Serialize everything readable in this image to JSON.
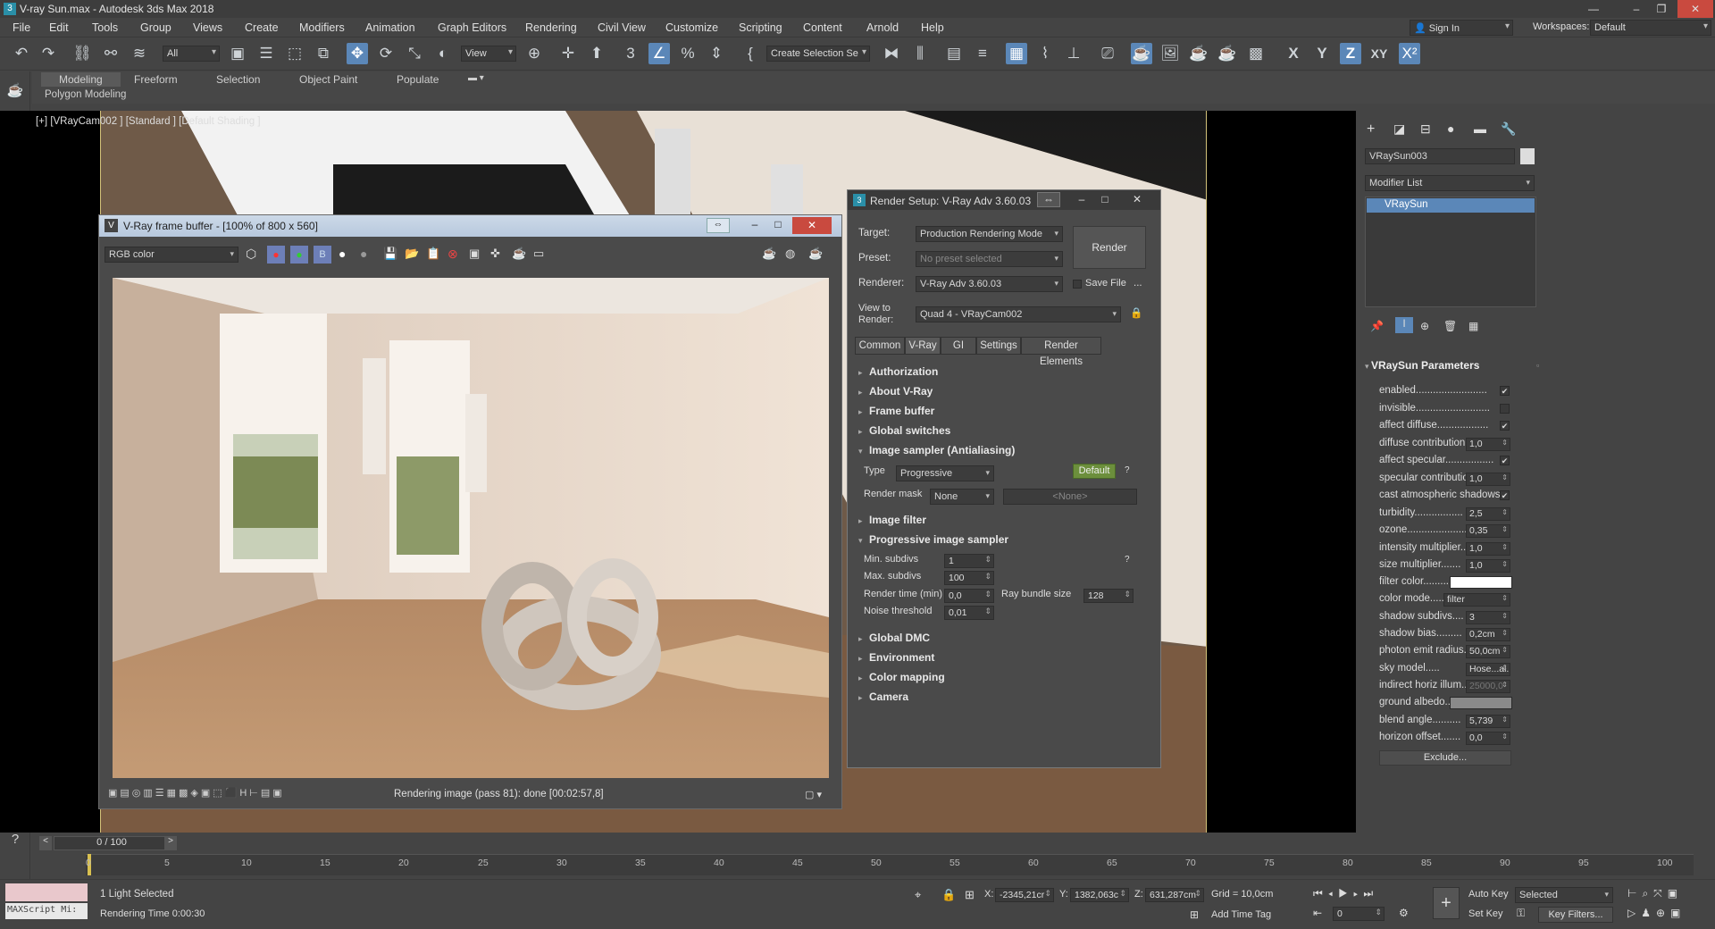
{
  "window": {
    "title": "V-ray Sun.max - Autodesk 3ds Max 2018"
  },
  "menu": [
    "File",
    "Edit",
    "Tools",
    "Group",
    "Views",
    "Create",
    "Modifiers",
    "Animation",
    "Graph Editors",
    "Rendering",
    "Civil View",
    "Customize",
    "Scripting",
    "Content",
    "Arnold",
    "Help"
  ],
  "account": {
    "sign_in": "Sign In",
    "workspaces_label": "Workspaces:",
    "workspace": "Default"
  },
  "toolbar": {
    "filter": "All",
    "ref_coord": "View",
    "selection_set": "Create Selection Se",
    "axes": [
      "X",
      "Y",
      "Z",
      "XY"
    ]
  },
  "ribbon": {
    "tabs": [
      "Modeling",
      "Freeform",
      "Selection",
      "Object Paint",
      "Populate"
    ],
    "sub": "Polygon Modeling"
  },
  "viewport": {
    "label_plus": "[+]",
    "label_cam": "[VRayCam002 ]",
    "label_std": "[Standard ]",
    "label_shading": "[Default Shading ]"
  },
  "vfb": {
    "title": "V-Ray frame buffer - [100% of 800 x 560]",
    "channel": "RGB color",
    "status": "Rendering image (pass 81): done [00:02:57,8]"
  },
  "render_setup": {
    "title": "Render Setup: V-Ray Adv 3.60.03",
    "target_label": "Target:",
    "target": "Production Rendering Mode",
    "preset_label": "Preset:",
    "preset": "No preset selected",
    "renderer_label": "Renderer:",
    "renderer": "V-Ray Adv 3.60.03",
    "save_file": "Save File",
    "ellipsis": "...",
    "view_label": "View to Render:",
    "view": "Quad 4 - VRayCam002",
    "render_button": "Render",
    "tabs": [
      "Common",
      "V-Ray",
      "GI",
      "Settings",
      "Render Elements"
    ],
    "rollouts_top": [
      "Authorization",
      "About V-Ray",
      "Frame buffer",
      "Global switches",
      "Image sampler (Antialiasing)"
    ],
    "type_label": "Type",
    "type": "Progressive",
    "default_btn": "Default",
    "help": "?",
    "mask_label": "Render mask",
    "mask": "None",
    "mask_none": "<None>",
    "image_filter": "Image filter",
    "progressive": "Progressive image sampler",
    "min_subdivs_label": "Min. subdivs",
    "min_subdivs": "1",
    "max_subdivs_label": "Max. subdivs",
    "max_subdivs": "100",
    "render_time_label": "Render time (min)",
    "render_time": "0,0",
    "bundle_label": "Ray bundle size",
    "bundle": "128",
    "noise_label": "Noise threshold",
    "noise": "0,01",
    "rollouts_bottom": [
      "Global DMC",
      "Environment",
      "Color mapping",
      "Camera"
    ]
  },
  "command_panel": {
    "object_name": "VRaySun003",
    "modifier_list": "Modifier List",
    "stack_item": "VRaySun",
    "params_title": "VRaySun Parameters",
    "params": [
      {
        "label": "enabled.........................",
        "check": "✔"
      },
      {
        "label": "invisible..........................",
        "check": ""
      },
      {
        "label": "affect diffuse..................",
        "check": "✔"
      },
      {
        "label": "diffuse contribution",
        "value": "1,0"
      },
      {
        "label": "affect specular.................",
        "check": "✔"
      },
      {
        "label": "specular contributio",
        "value": "1,0"
      },
      {
        "label": "cast atmospheric shadows..",
        "check": "✔"
      },
      {
        "label": "turbidity.................",
        "value": "2,5"
      },
      {
        "label": "ozone.....................",
        "value": "0,35"
      },
      {
        "label": "intensity multiplier..",
        "value": "1,0"
      },
      {
        "label": "size multiplier.......",
        "value": "1,0"
      },
      {
        "label": "filter color.........",
        "swatch": "#ffffff"
      },
      {
        "label": "color mode.....",
        "select": "filter"
      },
      {
        "label": "shadow subdivs....",
        "value": "3"
      },
      {
        "label": "shadow bias.........",
        "value": "0,2cm"
      },
      {
        "label": "photon emit radius.",
        "value": "50,0cm"
      },
      {
        "label": "sky model.....",
        "select": "Hose...al."
      },
      {
        "label": "indirect horiz illum..",
        "value": "25000,0"
      },
      {
        "label": "ground albedo..",
        "swatch": "#8a8a8a"
      },
      {
        "label": "blend angle..........",
        "value": "5,739"
      },
      {
        "label": "horizon offset.......",
        "value": "0,0"
      }
    ],
    "exclude": "Exclude..."
  },
  "timeline": {
    "frame": "0 / 100",
    "ticks": [
      "0",
      "5",
      "10",
      "15",
      "20",
      "25",
      "30",
      "35",
      "40",
      "45",
      "50",
      "55",
      "60",
      "65",
      "70",
      "75",
      "80",
      "85",
      "90",
      "95",
      "100"
    ]
  },
  "status": {
    "maxscript": "MAXScript Mi:",
    "selection": "1 Light Selected",
    "render_time": "Rendering Time 0:00:30",
    "x_label": "X:",
    "x": "-2345,21cr",
    "y_label": "Y:",
    "y": "1382,063c",
    "z_label": "Z:",
    "z": "631,287cm",
    "grid": "Grid = 10,0cm",
    "add_time_tag": "Add Time Tag",
    "auto_key": "Auto Key",
    "set_key": "Set Key",
    "key_mode": "Selected",
    "key_filters": "Key Filters...",
    "frame_field": "0"
  }
}
